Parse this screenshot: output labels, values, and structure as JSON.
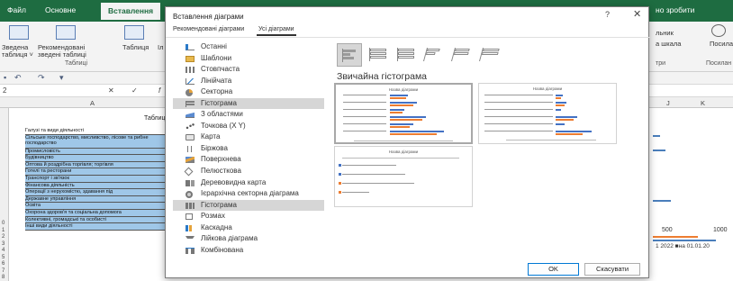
{
  "ribbon": {
    "tabs": [
      "Файл",
      "Основне",
      "Вставлення",
      "но зробити"
    ],
    "labels": {
      "pivot": "Зведена",
      "pivot2": "таблиця ˅",
      "recommended": "Рекомендовані",
      "recommended2": "зведені таблиці",
      "table": "Таблиця",
      "cut": "Іл",
      "right1": "льник",
      "right2": "а шкала",
      "right3": "Посилан",
      "right4": "три",
      "right5": "Посилан"
    },
    "group_tables": "Таблиці"
  },
  "formula_bar": {
    "cell_ref": "2",
    "cancel": "✕",
    "enter": "✓",
    "fx": "f"
  },
  "columns": [
    "A",
    "J",
    "K"
  ],
  "sheet": {
    "title": "Таблиця",
    "rows": [
      "Галузі та види діяльності",
      "Сільське господарство, мисливство, лісове та рибне господарство",
      "Промисловість",
      "Будівництво",
      "Оптова й роздрібна торгівля; торгівля",
      "Готелі та ресторани",
      "Транспорт і зв'язок",
      "Фінансова діяльність",
      "Операції з нерухомістю, здавання під",
      "Державне управління",
      "Освіта",
      "Охорона здоров'я та соціальна допомога",
      "Колективні, громадські та особисті",
      "Інші види діяльності"
    ],
    "row_numbers": [
      "0",
      "1",
      "2",
      "3",
      "4",
      "5",
      "6",
      "7",
      "8",
      "9"
    ],
    "axis_values": [
      "500",
      "1000"
    ],
    "legend_text": "1 2022  ■на 01.01.20"
  },
  "dialog": {
    "title": "Вставлення діаграми",
    "help": "?",
    "close": "✕",
    "tabs": [
      "Рекомендовані діаграми",
      "Усі діаграми"
    ],
    "categories": [
      {
        "label": "Останні",
        "icon": "recent-icon"
      },
      {
        "label": "Шаблони",
        "icon": "templates-icon"
      },
      {
        "label": "Стовпчаста",
        "icon": "column-chart-icon"
      },
      {
        "label": "Лінійчата",
        "icon": "line-chart-icon"
      },
      {
        "label": "Секторна",
        "icon": "pie-chart-icon"
      },
      {
        "label": "Гістограма",
        "icon": "bar-chart-icon"
      },
      {
        "label": "З областями",
        "icon": "area-chart-icon"
      },
      {
        "label": "Точкова (X Y)",
        "icon": "scatter-chart-icon"
      },
      {
        "label": "Карта",
        "icon": "map-chart-icon"
      },
      {
        "label": "Біржова",
        "icon": "stock-chart-icon"
      },
      {
        "label": "Поверхнева",
        "icon": "surface-chart-icon"
      },
      {
        "label": "Пелюсткова",
        "icon": "radar-chart-icon"
      },
      {
        "label": "Деревовидна карта",
        "icon": "treemap-chart-icon"
      },
      {
        "label": "Ієрархічна секторна діаграма",
        "icon": "sunburst-chart-icon"
      },
      {
        "label": "Гістограма",
        "icon": "histogram-chart-icon"
      },
      {
        "label": "Розмах",
        "icon": "box-whisker-chart-icon"
      },
      {
        "label": "Каскадна",
        "icon": "waterfall-chart-icon"
      },
      {
        "label": "Лійкова діаграма",
        "icon": "funnel-chart-icon"
      },
      {
        "label": "Комбінована",
        "icon": "combo-chart-icon"
      }
    ],
    "selected_category_index": 5,
    "selected_subtype_index": 0,
    "chart_heading": "Звичайна гістограма",
    "preview_title": "Назва діаграми",
    "ok_label": "OK",
    "cancel_label": "Скасувати"
  }
}
